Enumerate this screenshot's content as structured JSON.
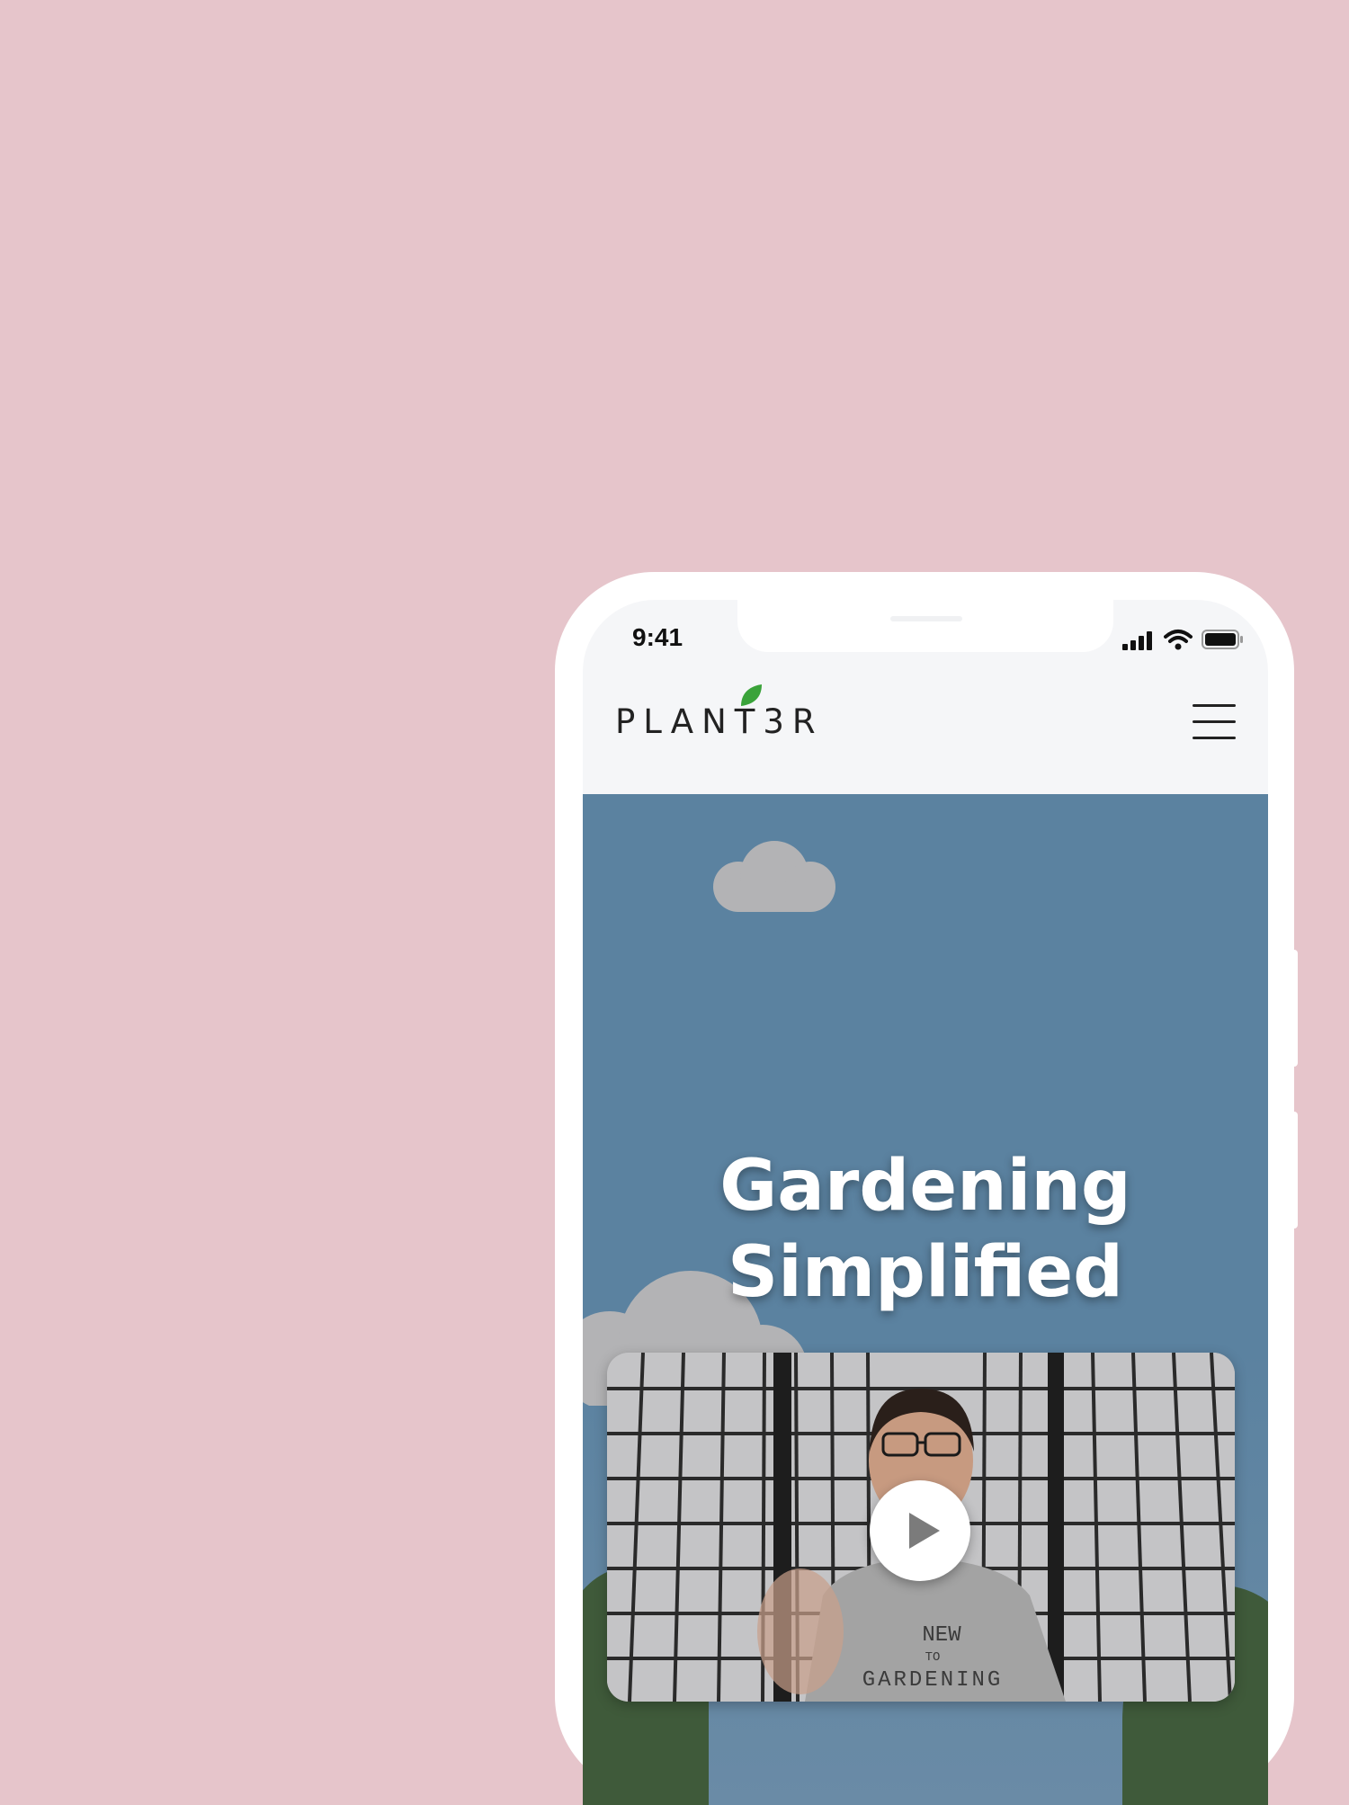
{
  "background_color": "#e6c5cb",
  "status_bar": {
    "time": "9:41",
    "icons": [
      "signal-icon",
      "wifi-icon",
      "battery-icon"
    ]
  },
  "header": {
    "logo_text": "PLANT3R",
    "logo_leaf_color": "#3aa33a",
    "menu_icon": "hamburger-menu-icon"
  },
  "hero": {
    "title_line1": "Gardening",
    "title_line2": "Simplified",
    "sky_color": "#5b82a0"
  },
  "video": {
    "play_icon": "play-icon",
    "shirt_text": [
      "NEW",
      "TO",
      "GARDENING"
    ]
  }
}
